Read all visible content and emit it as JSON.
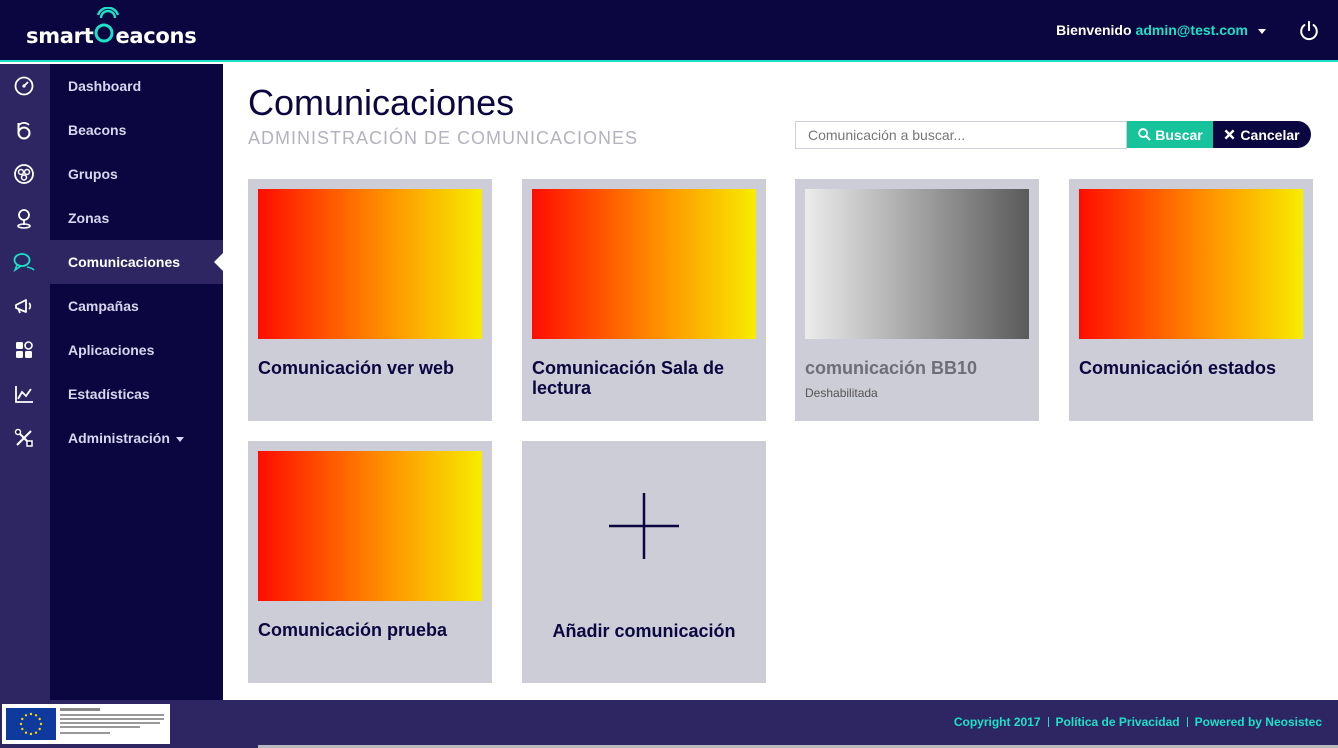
{
  "header": {
    "logo_text_a": "smart",
    "logo_text_b": "eacons",
    "welcome": "Bienvenido",
    "user": "admin@test.com"
  },
  "sidebar": {
    "items": [
      {
        "label": "Dashboard",
        "icon": "dashboard-icon"
      },
      {
        "label": "Beacons",
        "icon": "beacon-icon"
      },
      {
        "label": "Grupos",
        "icon": "groups-icon"
      },
      {
        "label": "Zonas",
        "icon": "location-pin-icon"
      },
      {
        "label": "Comunicaciones",
        "icon": "chat-icon",
        "active": true
      },
      {
        "label": "Campañas",
        "icon": "megaphone-icon"
      },
      {
        "label": "Aplicaciones",
        "icon": "apps-grid-icon"
      },
      {
        "label": "Estadísticas",
        "icon": "chart-icon"
      },
      {
        "label": "Administración",
        "icon": "tools-icon",
        "has_dropdown": true
      }
    ]
  },
  "page": {
    "title": "Comunicaciones",
    "subtitle": "ADMINISTRACIÓN DE COMUNICACIONES"
  },
  "search": {
    "placeholder": "Comunicación a buscar...",
    "value": "",
    "search_label": "Buscar",
    "cancel_label": "Cancelar"
  },
  "cards": [
    {
      "name": "Comunicación ver web",
      "status": "",
      "thumb": "gradient-red-yellow"
    },
    {
      "name": "Comunicación Sala de lectura",
      "status": "",
      "thumb": "gradient-red-yellow"
    },
    {
      "name": "comunicación BB10",
      "status": "Deshabilitada",
      "thumb": "gradient-gray"
    },
    {
      "name": "Comunicación estados",
      "status": "",
      "thumb": "gradient-red-yellow"
    },
    {
      "name": "Comunicación prueba",
      "status": "",
      "thumb": "gradient-red-yellow"
    }
  ],
  "add_card": {
    "label": "Añadir comunicación",
    "icon": "plus-icon"
  },
  "footer": {
    "copyright": "Copyright 2017",
    "privacy": "Política de Privacidad",
    "powered": "Powered by Neosistec"
  },
  "colors": {
    "navy": "#0b0640",
    "accent": "#1ee0c8",
    "green": "#16c39b",
    "rail": "#2d2663",
    "card": "#cdcdd8"
  }
}
